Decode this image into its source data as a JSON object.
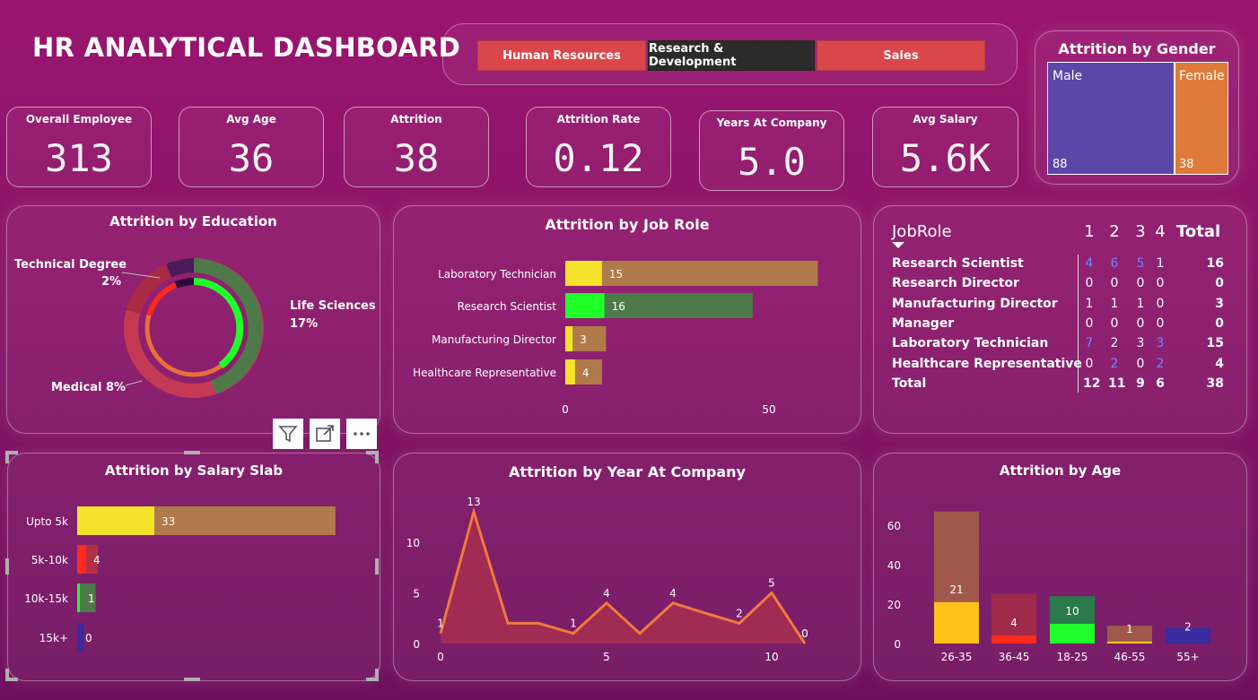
{
  "header": {
    "title": "HR ANALYTICAL DASHBOARD"
  },
  "slicer": {
    "buttons": [
      {
        "label": "Human Resources",
        "color": "#d9474b",
        "selected": false
      },
      {
        "label": "Research & Development",
        "color": "#2b2b2b",
        "selected": true
      },
      {
        "label": "Sales",
        "color": "#d9474b",
        "selected": false
      }
    ]
  },
  "kpis": [
    {
      "label": "Overall Employee",
      "value": "313"
    },
    {
      "label": "Avg Age",
      "value": "36"
    },
    {
      "label": "Attrition",
      "value": "38"
    },
    {
      "label": "Attrition Rate",
      "value": "0.12"
    },
    {
      "label": "Years At Company",
      "value": "5.0"
    },
    {
      "label": "Avg Salary",
      "value": "5.6K"
    }
  ],
  "gender": {
    "title": "Attrition by Gender",
    "male": {
      "label": "Male",
      "value": "88",
      "color": "#5b46aa"
    },
    "female": {
      "label": "Female",
      "value": "38",
      "color": "#e07a3a"
    }
  },
  "education": {
    "title": "Attrition by Education",
    "labels": [
      {
        "name": "Technical Degree",
        "pct": "2%"
      },
      {
        "name": "Life Sciences",
        "pct": "17%"
      },
      {
        "name": "Medical 8%"
      }
    ]
  },
  "jobrole_chart": {
    "title": "Attrition by Job Role",
    "chart_data": {
      "type": "bar",
      "orientation": "horizontal",
      "categories": [
        "Laboratory Technician",
        "Research Scientist",
        "Manufacturing Director",
        "Healthcare Representative"
      ],
      "values": [
        15,
        16,
        3,
        4
      ],
      "background_values": [
        62,
        46,
        10,
        9
      ],
      "xticks": [
        "0",
        "50"
      ],
      "xlim": [
        0,
        50
      ],
      "colors": {
        "bar": [
          "#f5e22a",
          "#1fff2a",
          "#f5e22a",
          "#f5e22a"
        ],
        "background": [
          "#b07a4a",
          "#4e7a4a",
          "#b07a4a",
          "#b07a4a"
        ]
      }
    }
  },
  "matrix": {
    "header": {
      "rowlabel": "JobRole",
      "cols": [
        "1",
        "2",
        "3",
        "4"
      ],
      "total": "Total"
    },
    "rows": [
      {
        "name": "Research Scientist",
        "cells": [
          "4",
          "6",
          "5",
          "1"
        ],
        "blue": [
          true,
          true,
          true,
          false
        ],
        "total": "16"
      },
      {
        "name": "Research Director",
        "cells": [
          "0",
          "0",
          "0",
          "0"
        ],
        "blue": [
          false,
          false,
          false,
          false
        ],
        "total": "0"
      },
      {
        "name": "Manufacturing Director",
        "cells": [
          "1",
          "1",
          "1",
          "0"
        ],
        "blue": [
          false,
          false,
          false,
          false
        ],
        "total": "3"
      },
      {
        "name": "Manager",
        "cells": [
          "0",
          "0",
          "0",
          "0"
        ],
        "blue": [
          false,
          false,
          false,
          false
        ],
        "total": "0"
      },
      {
        "name": "Laboratory Technician",
        "cells": [
          "7",
          "2",
          "3",
          "3"
        ],
        "blue": [
          true,
          false,
          false,
          true
        ],
        "total": "15"
      },
      {
        "name": "Healthcare Representative",
        "cells": [
          "0",
          "2",
          "0",
          "2"
        ],
        "blue": [
          false,
          true,
          false,
          true
        ],
        "total": "4"
      }
    ],
    "totals": {
      "name": "Total",
      "cells": [
        "12",
        "11",
        "9",
        "6"
      ],
      "total": "38"
    }
  },
  "salary_chart": {
    "title": "Attrition by Salary Slab",
    "chart_data": {
      "type": "bar",
      "orientation": "horizontal",
      "categories": [
        "Upto 5k",
        "5k-10k",
        "10k-15k",
        "15k+"
      ],
      "values": [
        33,
        4,
        1,
        0
      ],
      "background_values": [
        112,
        9,
        8,
        3
      ],
      "colors": {
        "bar": [
          "#f5e22a",
          "#ff2a1a",
          "#1fff2a",
          "#3a2aa0"
        ],
        "background": [
          "#b07a4a",
          "#b0304a",
          "#4e7a4a",
          "#3a2aa0"
        ]
      }
    }
  },
  "year_chart": {
    "title": "Attrition by Year At Company",
    "chart_data": {
      "type": "area",
      "x": [
        0,
        1,
        2,
        3,
        4,
        5,
        6,
        7,
        8,
        9,
        10,
        11
      ],
      "y": [
        1,
        13,
        2,
        2,
        1,
        4,
        1,
        4,
        3,
        2,
        5,
        0
      ],
      "point_labels": {
        "0": "1",
        "1": "13",
        "4": "1",
        "5": "4",
        "7": "4",
        "9": "2",
        "10": "5",
        "11": "0"
      },
      "xticks": [
        "0",
        "5",
        "10"
      ],
      "yticks": [
        "0",
        "5",
        "10"
      ],
      "ylim": [
        0,
        14
      ],
      "color": "#f07a3a"
    }
  },
  "age_chart": {
    "title": "Attrition by Age",
    "chart_data": {
      "type": "bar",
      "categories": [
        "26-35",
        "36-45",
        "18-25",
        "46-55",
        "55+"
      ],
      "values": [
        21,
        4,
        10,
        1,
        2
      ],
      "total_values": [
        67,
        25,
        24,
        9,
        8
      ],
      "yticks": [
        "0",
        "20",
        "40",
        "60"
      ],
      "ylim": [
        0,
        70
      ],
      "colors": {
        "bar": [
          "#ffc21a",
          "#ff2a1a",
          "#1fff2a",
          "#ffc21a",
          "#3a2aa0"
        ],
        "background": [
          "#a0584a",
          "#a02a4a",
          "#2a7a4a",
          "#a0584a",
          "#3a2aa0"
        ]
      }
    }
  }
}
